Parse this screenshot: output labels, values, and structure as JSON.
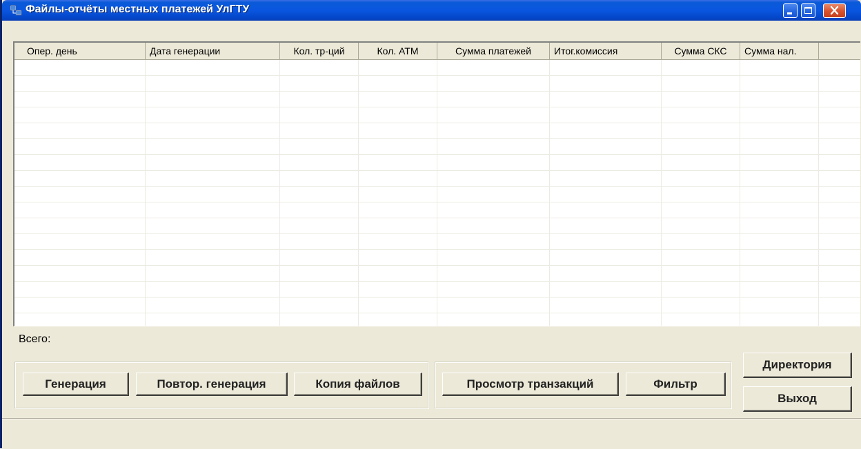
{
  "window": {
    "title": "Файлы-отчёты местных платежей УлГТУ",
    "accent": "#0a56e0"
  },
  "table": {
    "columns": [
      "Опер. день",
      "Дата генерации",
      "Кол. тр-ций",
      "Кол. АТМ",
      "Сумма платежей",
      "Итог.комиссия",
      "Сумма СКС",
      "Сумма нал."
    ],
    "rows": []
  },
  "summary": {
    "total_label": "Всего:"
  },
  "buttons": {
    "generate": "Генерация",
    "regenerate": "Повтор. генерация",
    "copy_files": "Копия файлов",
    "view_transactions": "Просмотр транзакций",
    "filter": "Фильтр",
    "directory": "Директория",
    "exit": "Выход"
  },
  "icons": {
    "title": "network-computers-icon",
    "minimize": "minimize-icon",
    "maximize": "maximize-icon",
    "close": "close-icon"
  }
}
